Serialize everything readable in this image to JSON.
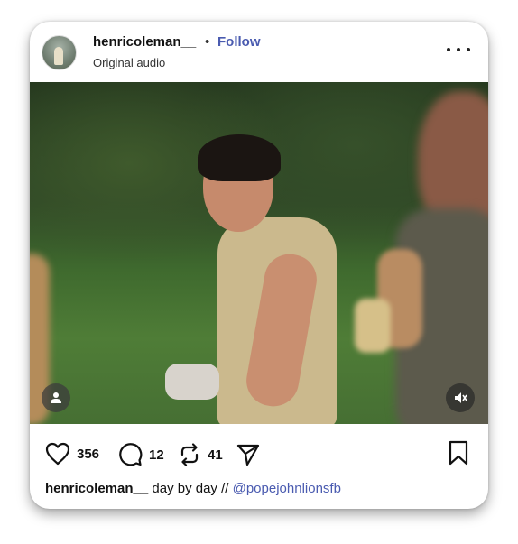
{
  "post": {
    "username": "henricoleman__",
    "separator": "•",
    "follow_label": "Follow",
    "audio_label": "Original audio",
    "more_icon": "more-horizontal-icon"
  },
  "media": {
    "user_tag_icon": "person-icon",
    "mute_icon": "speaker-muted-icon"
  },
  "actions": {
    "likes": "356",
    "comments": "12",
    "reposts": "41",
    "like_icon": "heart-icon",
    "comment_icon": "comment-bubble-icon",
    "repost_icon": "repost-icon",
    "share_icon": "paper-plane-icon",
    "save_icon": "bookmark-icon"
  },
  "caption": {
    "username": "henricoleman__",
    "text": " day by day // ",
    "mention": "@popejohnlionsfb"
  },
  "colors": {
    "link": "#4a5bb0",
    "text": "#111111"
  }
}
